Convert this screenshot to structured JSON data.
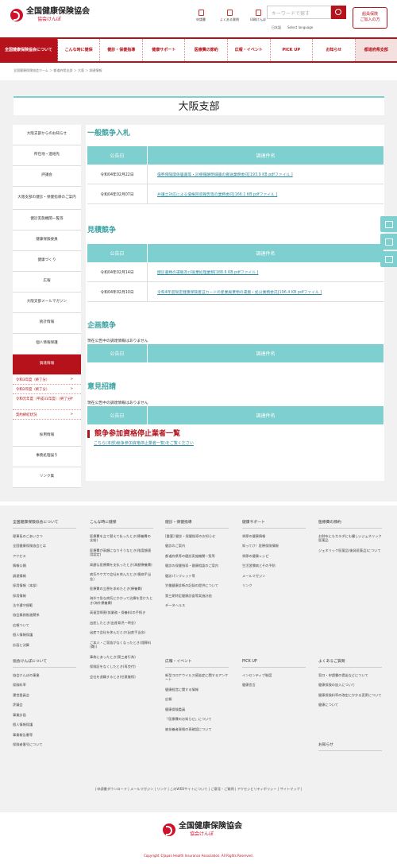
{
  "header": {
    "logo_main": "全国健康保険協会",
    "logo_sub": "協会けんぽ",
    "tools": [
      "申請書",
      "よくある質問",
      "印刷けんぽ"
    ],
    "search_placeholder": "キーワードで探す",
    "lang_ja": "日本語",
    "lang_select": "Select language",
    "right_btn": "船員保険\nご加入の方"
  },
  "nav": [
    "全国健康保険協会について",
    "こんな時に健保",
    "健診・保健指導",
    "健康サポート",
    "医療費の節約",
    "広報・イベント",
    "PICK UP",
    "お知らせ",
    "都道府県支部"
  ],
  "breadcrumb": "全国健康保険協会ホーム ＞ 都道府県支部 ＞ 大阪 ＞ 調達情報",
  "page_title": "大阪支部",
  "sidebar": [
    {
      "label": "大阪支部からのお知らせ"
    },
    {
      "label": "所在地・連絡先"
    },
    {
      "label": "評議会"
    },
    {
      "label": "大阪支部の健診・保健指導のご案内",
      "tall": true
    },
    {
      "label": "健診実施機関一覧等"
    },
    {
      "label": "健康保険委員"
    },
    {
      "label": "健康づくり"
    },
    {
      "label": "広報"
    },
    {
      "label": "大阪支部メールマガジン"
    },
    {
      "label": "統計情報"
    },
    {
      "label": "個人情報保護"
    },
    {
      "label": "調達情報",
      "active": true
    }
  ],
  "sub_items": [
    {
      "label": "令和3年度（終了分）"
    },
    {
      "label": "令和2年度（終了分）"
    },
    {
      "label": "令和元年度（平成31年度）（終了分）",
      "tall": true
    },
    {
      "label": "契約締結状況"
    }
  ],
  "sidebar2": [
    "採用情報",
    "事務処理誤り",
    "リンク集"
  ],
  "sections": {
    "ippan": {
      "title": "一般競争入札",
      "h1": "公告日",
      "h2": "調達件名",
      "rows": [
        {
          "date": "令和04年02月22日",
          "name": "債券保険関係届書等・診療報酬明細書の搬送業務委託[193.9 KB pdfファイル ]"
        },
        {
          "date": "令和04年02月07日",
          "name": "弁護士対応による債権回収報告等の業務委託[166.1 KB pdfファイル ]"
        }
      ]
    },
    "mitsumori": {
      "title": "見積競争",
      "h1": "公告日",
      "h2": "調達件名",
      "rows": [
        {
          "date": "令和04年02月14日",
          "name": "健診書類の運搬及び廃棄処理業務[188.6 KB pdfファイル ]"
        },
        {
          "date": "令和04年02月10日",
          "name": "令和4年度限定健康保険者証カードの産業廃棄物の運搬・処分業務委託[196.4 KB pdfファイル ]"
        }
      ]
    },
    "kikaku": {
      "title": "企画競争",
      "none": "現在公告中の調達情報はありません",
      "h1": "公告日",
      "h2": "調達件名"
    },
    "iken": {
      "title": "意見招請",
      "none": "現在公告中の調達情報はありません",
      "h1": "公告日",
      "h2": "調達件名"
    }
  },
  "stop": {
    "title": "競争参加資格停止業者一覧",
    "link": "こちら(本部)競争参加資格停止業者一覧)をご覧ください"
  },
  "footer": {
    "col1": {
      "head": "全国健康保険協会について",
      "items": [
        "理事長のごあいさつ",
        "全国健康保険協会とは",
        "アクセス",
        "情報公開",
        "調達情報",
        "採用情報（本部）",
        "採用情報",
        "法令遵守規範",
        "協会業務推進関係",
        "広報ついて",
        "個人情報保護",
        "計画と決算"
      ]
    },
    "col1b": {
      "head": "協会けんぽについて",
      "items": [
        "協会けんぽの事業",
        "保険料率",
        "運営委員会",
        "評議会",
        "事業計画",
        "個人情報保護",
        "事業報告書等",
        "保険者番号について"
      ]
    },
    "col2": {
      "head": "こんな時に健保",
      "items": [
        "医療費を立て替えて払ったとき(療養費の支給)",
        "医療費が高額になりそうなとき(限度額適用認定)",
        "高額な医療費を支払ったとき(高額療養費)",
        "病気やケガで会社を休んだとき(傷病手当金)",
        "医療費の立替を求めたとき(療養費)",
        "海外で急な病気にかかって治療を受けたとき(海外療養費)",
        "高速型障害(仮業務・保養料)の手続き",
        "出産したとき(出産育児一時金)",
        "出産で会社を休んだとき(出産手当金)",
        "ご本人・ご家族がなくなったとき(埋葬料(費))",
        "事故にあったとき(第三者行為)",
        "保険証をなくしたとき(再交付)",
        "会社を退職するとき(任意継続)"
      ]
    },
    "col3": {
      "head": "健診・保健指導",
      "items": [
        "[重要] 健診・保健指導のお知らせ",
        "健診のご案内",
        "都道府県等の健診実施機関一覧等",
        "健診の保健指導・健康相談のご案内",
        "健診パンフレット等",
        "労働健康診断の記録の提供について",
        "第三期特定健康診査等実施計画",
        "データヘルス"
      ]
    },
    "col3b": {
      "head": "広報・イベント",
      "items": [
        "新型コロナウイルス感染症に関するアンケート",
        "健康経営に関する情報",
        "広報",
        "健康保険委員",
        "「医療費のお知らせ」について",
        "被扶養者資格の再確認について"
      ]
    },
    "col4": {
      "head": "健康サポート",
      "items": [
        "季節の健康情報",
        "知ってけ！医療保険情報",
        "季節の健康レシピ",
        "生活習慣病とその予防",
        "メールマガジン",
        "リンク"
      ]
    },
    "col4b": {
      "head": "PICK UP",
      "items": [
        "インセンティブ制度",
        "健康宣言"
      ]
    },
    "col5": {
      "head": "医療費の節約",
      "items": [
        "お財布にもカラダにも優しいジェネリック医薬品",
        "ジェネリック医薬品(後発医薬品)について"
      ]
    },
    "col5b": {
      "head": "よくあるご質問",
      "items": [
        "窓口・申請書の提出などについて",
        "健康保険の加入について",
        "健康保険料率の改定にかかる変更について",
        "健康について"
      ]
    },
    "col5c": {
      "head": "お知らせ",
      "items": []
    },
    "bar": "| 申請書ダウンロード | メールマガジン | リンク | このWEBサイトについて | ご意見・ご質問 | アクセシビリティポリシー | サイトマップ |",
    "logo_main": "全国健康保険協会",
    "logo_sub": "協会けんぽ",
    "copy": "Copyright ©Japan Health Insurance Association. All Rights Reserved."
  }
}
